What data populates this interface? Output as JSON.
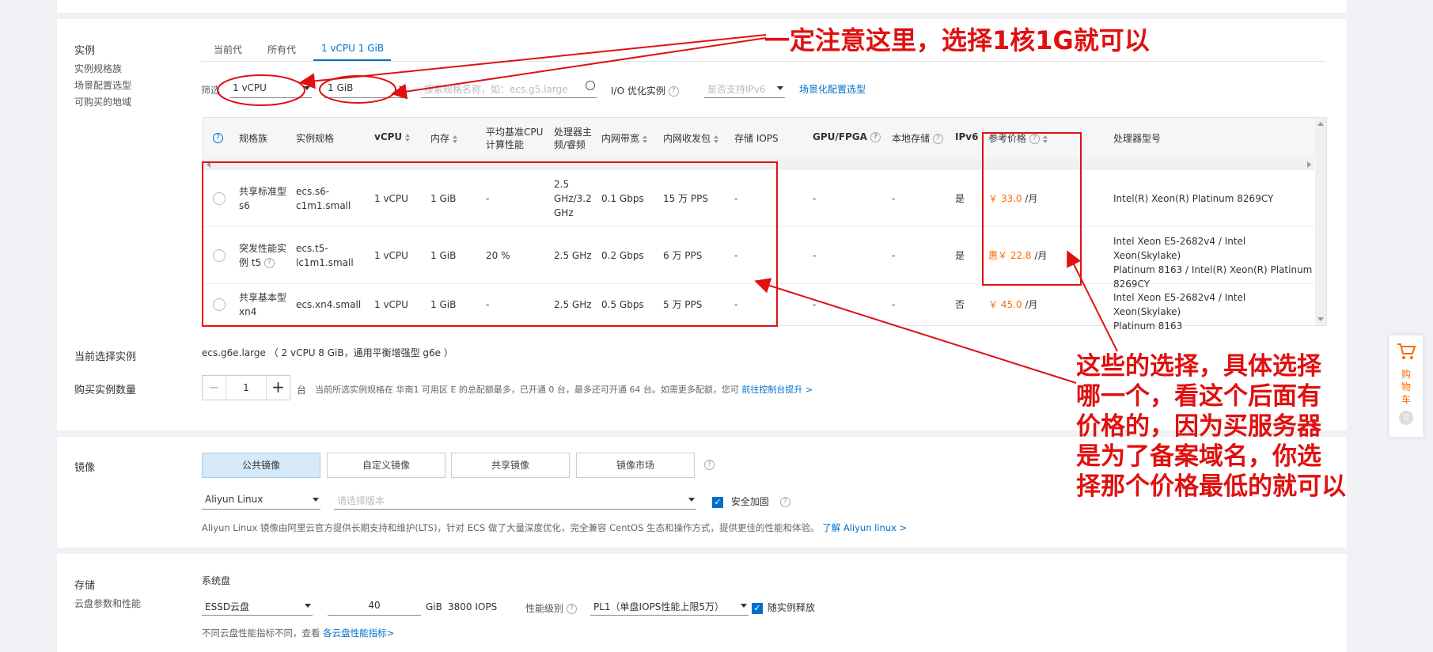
{
  "instance": {
    "title": "实例",
    "subs": [
      "实例规格族",
      "场景配置选型",
      "可购买的地域"
    ],
    "tabs": [
      "当前代",
      "所有代",
      "1 vCPU 1 GiB"
    ],
    "filter_label": "筛选",
    "vcpu_select": "1 vCPU",
    "mem_select": "1 GiB",
    "search_placeholder": "搜索规格名称，如：ecs.g5.large",
    "io_label": "I/O 优化实例",
    "ipv6_select": "是否支持IPv6",
    "scene_link": "场景化配置选型"
  },
  "table": {
    "headers": {
      "family": "规格族",
      "spec": "实例规格",
      "vcpu": "vCPU",
      "mem": "内存",
      "baseline_1": "平均基准CPU",
      "baseline_2": "计算性能",
      "freq_1": "处理器主",
      "freq_2": "频/睿频",
      "bandwidth": "内网带宽",
      "pps": "内网收发包",
      "iops": "存储 IOPS",
      "gpu": "GPU/FPGA",
      "local": "本地存储",
      "ipv6": "IPv6",
      "price": "参考价格",
      "cpu_model": "处理器型号"
    },
    "rows": [
      {
        "family_1": "共享标准型",
        "family_2": "s6",
        "spec_1": "ecs.s6-",
        "spec_2": "c1m1.small",
        "vcpu": "1 vCPU",
        "mem": "1 GiB",
        "baseline": "-",
        "freq_1": "2.5",
        "freq_2": "GHz/3.2",
        "freq_3": "GHz",
        "bandwidth": "0.1 Gbps",
        "pps": "15 万 PPS",
        "iops": "-",
        "gpu": "-",
        "local": "-",
        "ipv6": "是",
        "price": "￥ 33.0",
        "unit": "/月",
        "cpu_model_1": "Intel(R) Xeon(R) Platinum 8269CY",
        "cpu_model_2": "",
        "cpu_model_3": ""
      },
      {
        "family_1": "突发性能实",
        "family_2": "例 t5",
        "spec_1": "ecs.t5-",
        "spec_2": "lc1m1.small",
        "vcpu": "1 vCPU",
        "mem": "1 GiB",
        "baseline": "20 %",
        "freq_1": "2.5 GHz",
        "freq_2": "",
        "freq_3": "",
        "bandwidth": "0.2 Gbps",
        "pps": "6 万 PPS",
        "iops": "-",
        "gpu": "-",
        "local": "-",
        "ipv6": "是",
        "price": "惠￥ 22.8",
        "unit": "/月",
        "cpu_model_1": "Intel Xeon E5-2682v4 / Intel Xeon(Skylake)",
        "cpu_model_2": "Platinum 8163 / Intel(R) Xeon(R) Platinum",
        "cpu_model_3": "8269CY"
      },
      {
        "family_1": "共享基本型",
        "family_2": "xn4",
        "spec_1": "ecs.xn4.small",
        "spec_2": "",
        "vcpu": "1 vCPU",
        "mem": "1 GiB",
        "baseline": "-",
        "freq_1": "2.5 GHz",
        "freq_2": "",
        "freq_3": "",
        "bandwidth": "0.5 Gbps",
        "pps": "5 万 PPS",
        "iops": "-",
        "gpu": "-",
        "local": "-",
        "ipv6": "否",
        "price": "￥ 45.0",
        "unit": "/月",
        "cpu_model_1": "Intel Xeon E5-2682v4 / Intel Xeon(Skylake)",
        "cpu_model_2": "Platinum 8163",
        "cpu_model_3": ""
      }
    ]
  },
  "current": {
    "label": "当前选择实例",
    "value": "ecs.g6e.large （ 2 vCPU 8 GiB，通用平衡增强型 g6e ）"
  },
  "quantity": {
    "label": "购买实例数量",
    "minus": "−",
    "value": "1",
    "plus": "+",
    "unit": "台",
    "note": "当前所选实例规格在 华南1 可用区 E 的总配额最多，已开通 0 台，最多还可开通 64 台。如需更多配额，您可",
    "link": "前往控制台提升 >"
  },
  "image": {
    "title": "镜像",
    "tabs": [
      "公共镜像",
      "自定义镜像",
      "共享镜像",
      "镜像市场"
    ],
    "os_select": "Aliyun Linux",
    "version_placeholder": "请选择版本",
    "security_label": "安全加固",
    "desc": "Aliyun Linux 镜像由阿里云官方提供长期支持和维护(LTS)，针对 ECS 做了大量深度优化，完全兼容 CentOS 生态和操作方式，提供更佳的性能和体验。",
    "desc_link": "了解 Aliyun linux >"
  },
  "storage": {
    "title": "存储",
    "sub": "云盘参数和性能",
    "system_disk": "系统盘",
    "disk_type": "ESSD云盘",
    "size": "40",
    "size_unit": "GiB",
    "iops": "3800 IOPS",
    "perf_label": "性能级别",
    "perf_select": "PL1（单盘IOPS性能上限5万）",
    "release_label": "随实例释放",
    "note": "不同云盘性能指标不同，查看",
    "note_link": "各云盘性能指标>"
  },
  "cart": {
    "label": "购物车",
    "count": "0"
  },
  "annotations": {
    "top": "一定注意这里，选择1核1G就可以",
    "bottom_1": "这些的选择，具体选择",
    "bottom_2": "哪一个，看这个后面有",
    "bottom_3": "价格的，因为买服务器",
    "bottom_4": "是为了备案域名，你选",
    "bottom_5": "择那个价格最低的就可以"
  },
  "colors": {
    "accent": "#0070cc",
    "price": "#ff6a00",
    "annotation": "#e01010"
  }
}
